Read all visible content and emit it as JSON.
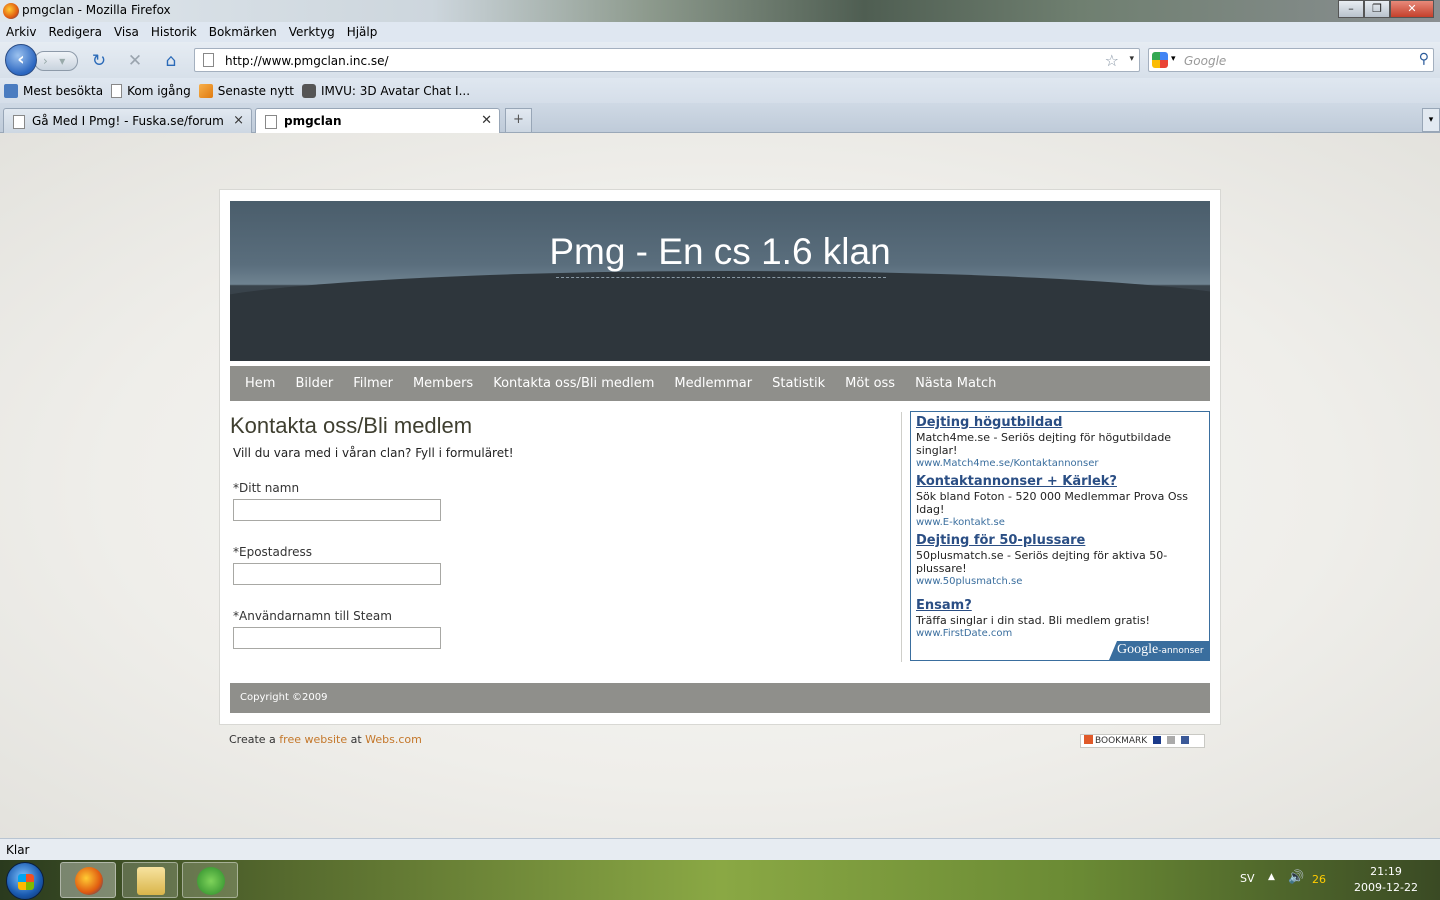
{
  "window": {
    "title": "pmgclan - Mozilla Firefox"
  },
  "menubar": {
    "items": [
      "Arkiv",
      "Redigera",
      "Visa",
      "Historik",
      "Bokmärken",
      "Verktyg",
      "Hjälp"
    ]
  },
  "navbar": {
    "url": "http://www.pmgclan.inc.se/",
    "search_placeholder": "Google"
  },
  "bookmarks": {
    "items": [
      "Mest besökta",
      "Kom igång",
      "Senaste nytt",
      "IMVU: 3D Avatar Chat I..."
    ]
  },
  "tabs": [
    {
      "label": "Gå Med I Pmg! - Fuska.se/forum",
      "active": false
    },
    {
      "label": "pmgclan",
      "active": true
    }
  ],
  "site": {
    "title": "Pmg - En cs 1.6 klan",
    "nav": [
      "Hem",
      "Bilder",
      "Filmer",
      "Members",
      "Kontakta oss/Bli medlem",
      "Medlemmar",
      "Statistik",
      "Möt oss",
      "Nästa Match"
    ],
    "heading": "Kontakta oss/Bli medlem",
    "intro": "Vill du vara med i våran clan? Fyll i formuläret!",
    "fields": [
      {
        "label": "*Ditt namn",
        "value": ""
      },
      {
        "label": "*Epostadress",
        "value": ""
      },
      {
        "label": "*Användarnamn till Steam",
        "value": ""
      }
    ],
    "ads": [
      {
        "title": "Dejting högutbildad",
        "desc": "Match4me.se - Seriös dejting för högutbildade singlar!",
        "url": "www.Match4me.se/Kontaktannonser"
      },
      {
        "title": "Kontaktannonser + Kärlek?",
        "desc": "Sök bland Foton - 520 000 Medlemmar Prova Oss Idag!",
        "url": "www.E-kontakt.se"
      },
      {
        "title": "Dejting för 50-plussare",
        "desc": "50plusmatch.se - Seriös dejting för aktiva 50-plussare!",
        "url": "www.50plusmatch.se"
      },
      {
        "title": "Ensam?",
        "desc": "Träffa singlar i din stad. Bli medlem gratis!",
        "url": "www.FirstDate.com"
      }
    ],
    "ads_badge": {
      "brand": "Google",
      "suffix": "-annonser"
    },
    "copyright": "Copyright ©2009",
    "credit": {
      "prefix": "Create a ",
      "link1": "free website",
      "mid": " at ",
      "link2": "Webs.com"
    },
    "bookmark_label": "BOOKMARK"
  },
  "status": {
    "text": "Klar"
  },
  "taskbar": {
    "lang": "SV",
    "tray_num": "26",
    "time": "21:19",
    "date": "2009-12-22"
  }
}
